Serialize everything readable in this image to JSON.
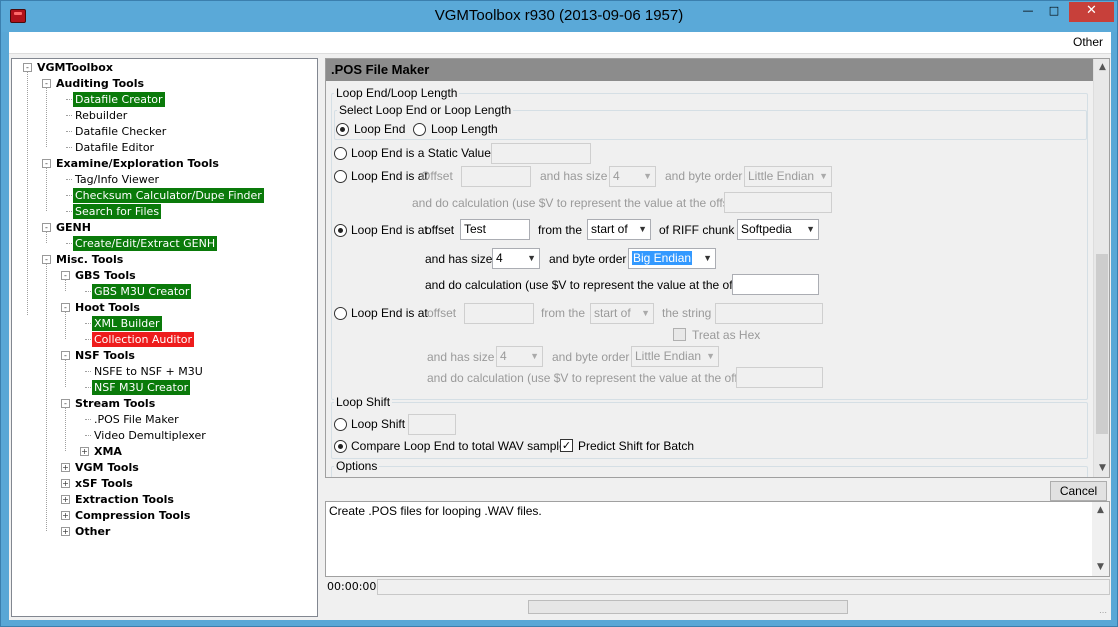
{
  "window": {
    "title": "VGMToolbox r930 (2013-09-06 1957)"
  },
  "menu": {
    "other": "Other"
  },
  "tree": {
    "root": "VGMToolbox",
    "auditing": "Auditing Tools",
    "datafile_creator": "Datafile Creator",
    "rebuilder": "Rebuilder",
    "datafile_checker": "Datafile Checker",
    "datafile_editor": "Datafile Editor",
    "examine": "Examine/Exploration Tools",
    "tag_info": "Tag/Info Viewer",
    "checksum": "Checksum Calculator/Dupe Finder",
    "search_files": "Search for Files",
    "genh": "GENH",
    "genh_create": "Create/Edit/Extract GENH",
    "misc": "Misc. Tools",
    "gbs": "GBS Tools",
    "gbs_m3u": "GBS M3U Creator",
    "hoot": "Hoot Tools",
    "xml_builder": "XML Builder",
    "collection_auditor": "Collection Auditor",
    "nsf": "NSF Tools",
    "nsfe_to_nsf": "NSFE to NSF + M3U",
    "nsf_m3u": "NSF M3U Creator",
    "stream": "Stream Tools",
    "pos_maker": ".POS File Maker",
    "video_demux": "Video Demultiplexer",
    "xma": "XMA",
    "vgm": "VGM Tools",
    "xsf": "xSF Tools",
    "extraction": "Extraction Tools",
    "compression": "Compression Tools",
    "other": "Other"
  },
  "panel": {
    "header": ".POS File Maker",
    "loop_group": "Loop End/Loop Length",
    "select_group": "Select Loop End or Loop Length",
    "radio_loop_end": "Loop End",
    "radio_loop_length": "Loop Length",
    "static_value": "Loop End is a Static Value",
    "loop_end_at": "Loop End is at",
    "offset": "offset",
    "offset_cap": "Offset",
    "has_size": "and has size",
    "byte_order": "and byte order",
    "calc": "and do calculation (use $V to represent the value at the offset)",
    "row1": {
      "size": "4",
      "byte_order": "Little Endian"
    },
    "row2": {
      "offset_value": "Test",
      "from_the": "from the",
      "position": "start of",
      "of_riff": "of RIFF chunk",
      "chunk": "Softpedia",
      "size": "4",
      "byte_order": "Big Endian"
    },
    "row3": {
      "from_the": "from the",
      "position": "start of",
      "the_string": "the string",
      "treat_hex": "Treat as Hex",
      "size": "4",
      "byte_order": "Little Endian"
    },
    "loop_shift_group": "Loop Shift",
    "loop_shift": "Loop Shift",
    "compare": "Compare Loop End to total WAV samples",
    "predict": "Predict Shift for Batch",
    "options_group": "Options"
  },
  "buttons": {
    "cancel": "Cancel"
  },
  "log": {
    "text": "Create .POS files for looping .WAV files."
  },
  "status": {
    "time": "00:00:00",
    "progress": 0
  }
}
